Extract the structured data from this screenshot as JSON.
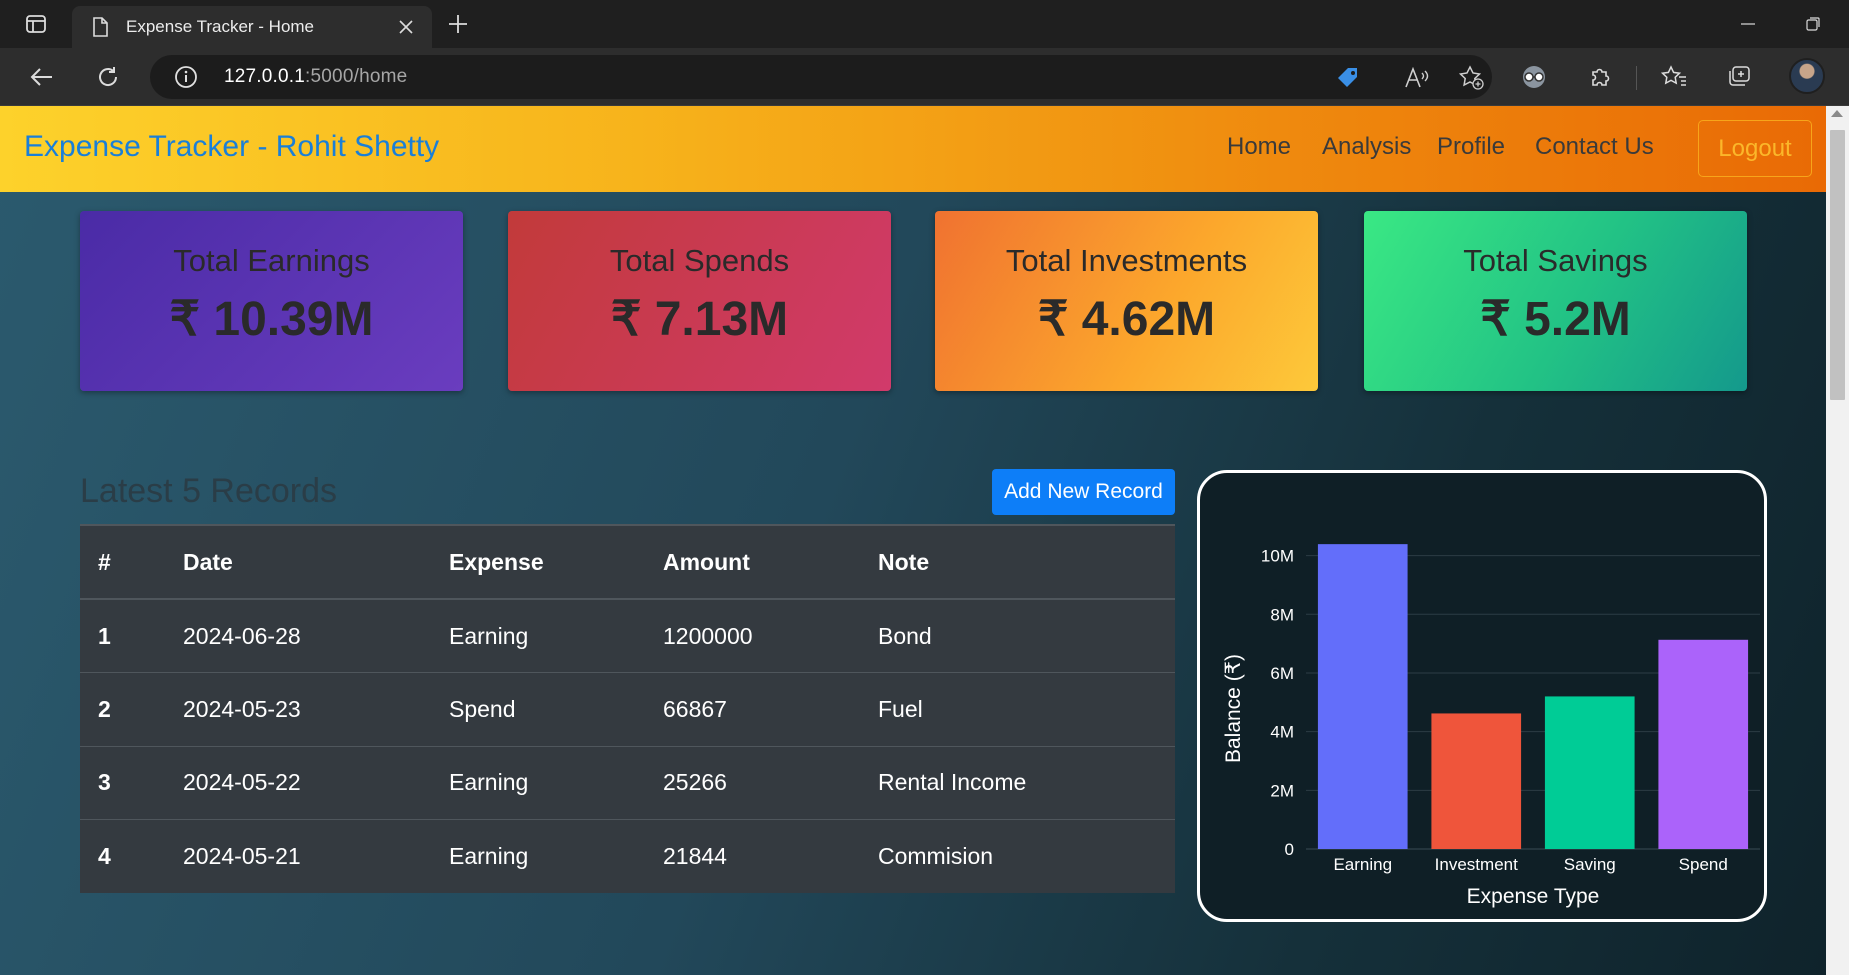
{
  "browser": {
    "tab_title": "Expense Tracker - Home",
    "url_host": "127.0.0.1",
    "url_rest": ":5000/home"
  },
  "navbar": {
    "brand": "Expense Tracker - Rohit Shetty",
    "links": [
      "Home",
      "Analysis",
      "Profile",
      "Contact Us"
    ],
    "logout_label": "Logout"
  },
  "summary": {
    "earnings": {
      "title": "Total Earnings",
      "value": "₹ 10.39M"
    },
    "spends": {
      "title": "Total Spends",
      "value": "₹ 7.13M"
    },
    "investments": {
      "title": "Total Investments",
      "value": "₹ 4.62M"
    },
    "savings": {
      "title": "Total Savings",
      "value": "₹ 5.2M"
    }
  },
  "records": {
    "title": "Latest 5 Records",
    "add_button": "Add New Record",
    "columns": [
      "#",
      "Date",
      "Expense",
      "Amount",
      "Note"
    ],
    "rows": [
      [
        "1",
        "2024-06-28",
        "Earning",
        "1200000",
        "Bond"
      ],
      [
        "2",
        "2024-05-23",
        "Spend",
        "66867",
        "Fuel"
      ],
      [
        "3",
        "2024-05-22",
        "Earning",
        "25266",
        "Rental Income"
      ],
      [
        "4",
        "2024-05-21",
        "Earning",
        "21844",
        "Commision"
      ]
    ]
  },
  "chart_data": {
    "type": "bar",
    "categories": [
      "Earning",
      "Investment",
      "Saving",
      "Spend"
    ],
    "values": [
      10390000,
      4620000,
      5200000,
      7130000
    ],
    "colors": [
      "#636efa",
      "#ef553b",
      "#00cc96",
      "#ab63fa"
    ],
    "xlabel": "Expense Type",
    "ylabel": "Balance (₹)",
    "yticks": [
      "0",
      "2M",
      "4M",
      "6M",
      "8M",
      "10M"
    ],
    "ytick_values": [
      0,
      2000000,
      4000000,
      6000000,
      8000000,
      10000000
    ],
    "ylim": [
      0,
      10940000
    ],
    "grid": true
  }
}
